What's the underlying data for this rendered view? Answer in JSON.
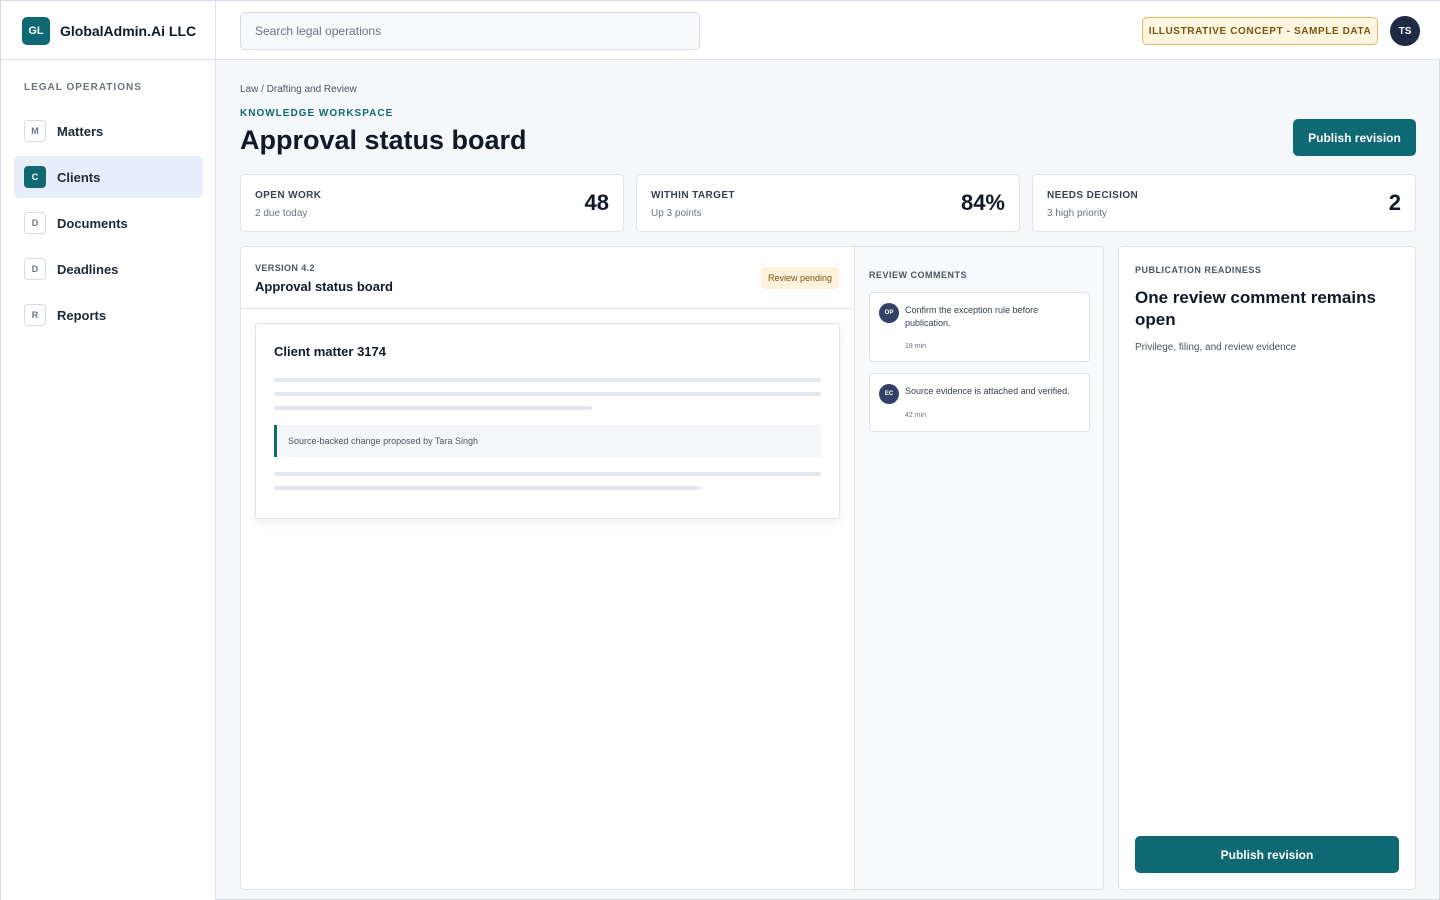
{
  "brand": {
    "logo": "GL",
    "name": "GlobalAdmin.Ai LLC"
  },
  "search": {
    "placeholder": "Search legal operations"
  },
  "header": {
    "badge": "ILLUSTRATIVE CONCEPT - SAMPLE DATA",
    "user_initials": "TS"
  },
  "sidebar": {
    "heading": "LEGAL OPERATIONS",
    "items": [
      {
        "icon": "M",
        "label": "Matters",
        "active": false
      },
      {
        "icon": "C",
        "label": "Clients",
        "active": true
      },
      {
        "icon": "D",
        "label": "Documents",
        "active": false
      },
      {
        "icon": "D",
        "label": "Deadlines",
        "active": false
      },
      {
        "icon": "R",
        "label": "Reports",
        "active": false
      }
    ]
  },
  "page": {
    "breadcrumb": "Law / Drafting and Review",
    "kicker": "KNOWLEDGE WORKSPACE",
    "title": "Approval status board",
    "primary_action": "Publish revision"
  },
  "stats": [
    {
      "label": "OPEN WORK",
      "sub": "2 due today",
      "value": "48"
    },
    {
      "label": "WITHIN TARGET",
      "sub": "Up 3 points",
      "value": "84%"
    },
    {
      "label": "NEEDS DECISION",
      "sub": "3 high priority",
      "value": "2"
    }
  ],
  "document": {
    "version": "VERSION 4.2",
    "title": "Approval status board",
    "status": "Review pending",
    "card_title": "Client matter 3174",
    "note": "Source-backed change proposed by Tara Singh"
  },
  "comments": {
    "heading": "REVIEW COMMENTS",
    "items": [
      {
        "initials": "OP",
        "text": "Confirm the exception rule before publication.",
        "time": "18 min"
      },
      {
        "initials": "EC",
        "text": "Source evidence is attached and verified.",
        "time": "42 min"
      }
    ]
  },
  "readiness": {
    "heading": "PUBLICATION READINESS",
    "title": "One review comment remains open",
    "sub": "Privilege, filing, and review evidence",
    "action": "Publish revision"
  },
  "colors": {
    "accent": "#0f6973",
    "badge_bg": "#fdf5df",
    "badge_text": "#7a5410",
    "active_nav": "#e8eef9"
  }
}
